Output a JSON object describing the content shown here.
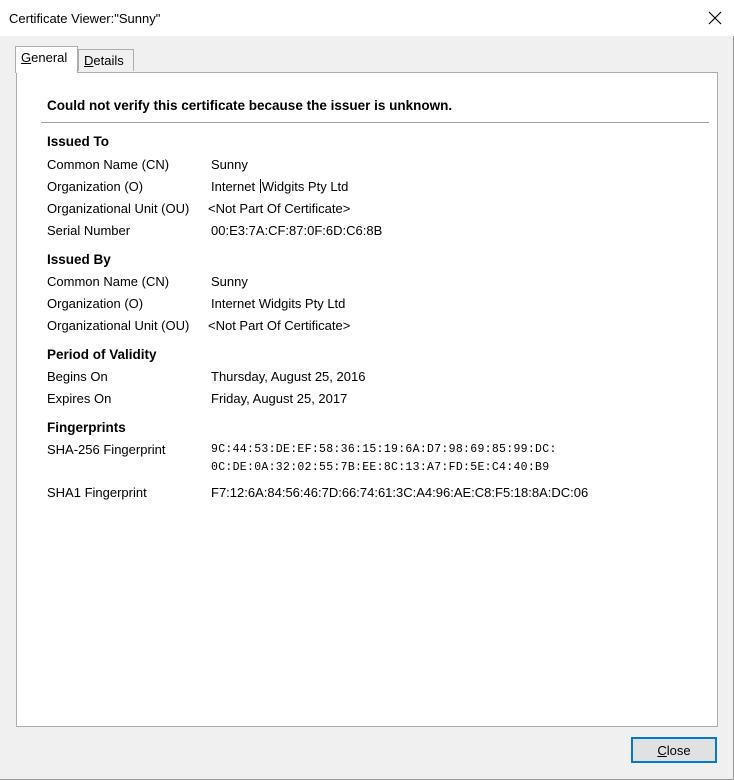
{
  "window": {
    "title": "Certificate Viewer:\"Sunny\""
  },
  "tabs": [
    {
      "label_u": "G",
      "label_rest": "eneral",
      "active": true
    },
    {
      "label_u": "D",
      "label_rest": "etails",
      "active": false
    }
  ],
  "warning": "Could not verify this certificate because the issuer is unknown.",
  "issued_to": {
    "title": "Issued To",
    "rows": [
      {
        "label": "Common Name (CN)",
        "value": "Sunny"
      },
      {
        "label": "Organization (O)",
        "value_a": "Internet ",
        "value_b": "Widgits Pty Ltd"
      },
      {
        "label": "Organizational Unit (OU)",
        "value": "<Not Part Of Certificate>"
      },
      {
        "label": "Serial Number",
        "value": "00:E3:7A:CF:87:0F:6D:C6:8B"
      }
    ]
  },
  "issued_by": {
    "title": "Issued By",
    "rows": [
      {
        "label": "Common Name (CN)",
        "value": "Sunny"
      },
      {
        "label": "Organization (O)",
        "value": "Internet Widgits Pty Ltd"
      },
      {
        "label": "Organizational Unit (OU)",
        "value": "<Not Part Of Certificate>"
      }
    ]
  },
  "validity": {
    "title": "Period of Validity",
    "rows": [
      {
        "label": "Begins On",
        "value": "Thursday, August 25, 2016"
      },
      {
        "label": "Expires On",
        "value": "Friday, August 25, 2017"
      }
    ]
  },
  "fingerprints": {
    "title": "Fingerprints",
    "sha256_label": "SHA-256 Fingerprint",
    "sha256_line1": "9C:44:53:DE:EF:58:36:15:19:6A:D7:98:69:85:99:DC:",
    "sha256_line2": "0C:DE:0A:32:02:55:7B:EE:8C:13:A7:FD:5E:C4:40:B9",
    "sha1_label": "SHA1 Fingerprint",
    "sha1_value": "F7:12:6A:84:56:46:7D:66:74:61:3C:A4:96:AE:C8:F5:18:8A:DC:06"
  },
  "footer": {
    "close_u": "C",
    "close_rest": "lose"
  }
}
